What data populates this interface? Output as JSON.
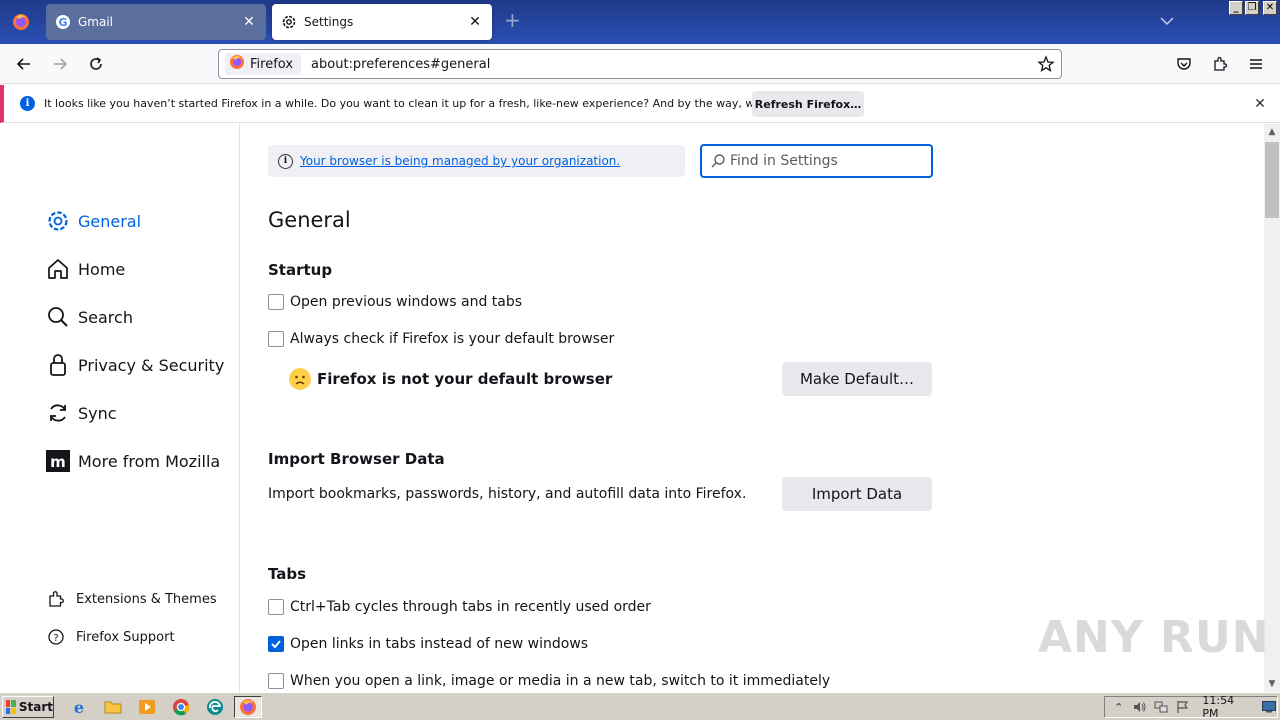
{
  "browser": {
    "tabs": [
      {
        "label": "Gmail",
        "active": false
      },
      {
        "label": "Settings",
        "active": true
      }
    ],
    "new_tab_label": "+",
    "identity_label": "Firefox",
    "url": "about:preferences#general"
  },
  "notification": {
    "message": "It looks like you haven’t started Firefox in a while. Do you want to clean it up for a fresh, like-new experience? And by the way, welcome back!",
    "button": "Refresh Firefox…"
  },
  "sidebar": {
    "categories": [
      {
        "label": "General",
        "icon": "gear-icon",
        "selected": true
      },
      {
        "label": "Home",
        "icon": "home-icon",
        "selected": false
      },
      {
        "label": "Search",
        "icon": "search-icon",
        "selected": false
      },
      {
        "label": "Privacy & Security",
        "icon": "lock-icon",
        "selected": false
      },
      {
        "label": "Sync",
        "icon": "sync-icon",
        "selected": false
      },
      {
        "label": "More from Mozilla",
        "icon": "mozilla-icon",
        "selected": false
      }
    ],
    "footer": [
      {
        "label": "Extensions & Themes",
        "icon": "puzzle-icon"
      },
      {
        "label": "Firefox Support",
        "icon": "help-icon"
      }
    ]
  },
  "main": {
    "policies_link": "Your browser is being managed by your organization.",
    "search_placeholder": "Find in Settings",
    "title": "General",
    "startup": {
      "heading": "Startup",
      "option_restore": "Open previous windows and tabs",
      "option_default_check": "Always check if Firefox is your default browser",
      "not_default_text": "Firefox is not your default browser",
      "make_default_button": "Make Default…"
    },
    "import": {
      "heading": "Import Browser Data",
      "description": "Import bookmarks, passwords, history, and autofill data into Firefox.",
      "button": "Import Data"
    },
    "tabs": {
      "heading": "Tabs",
      "option_ctrl_tab": "Ctrl+Tab cycles through tabs in recently used order",
      "option_links_in_tabs": "Open links in tabs instead of new windows",
      "option_switch_to_tab": "When you open a link, image or media in a new tab, switch to it immediately",
      "checked": [
        false,
        true,
        false
      ]
    }
  },
  "watermark": "ANY RUN",
  "taskbar": {
    "start_label": "Start",
    "clock": "11:54 PM"
  },
  "colors": {
    "accent": "#0061e0",
    "tabstrip": "#1f3a8a",
    "notification_stripe": "#e3316d"
  }
}
